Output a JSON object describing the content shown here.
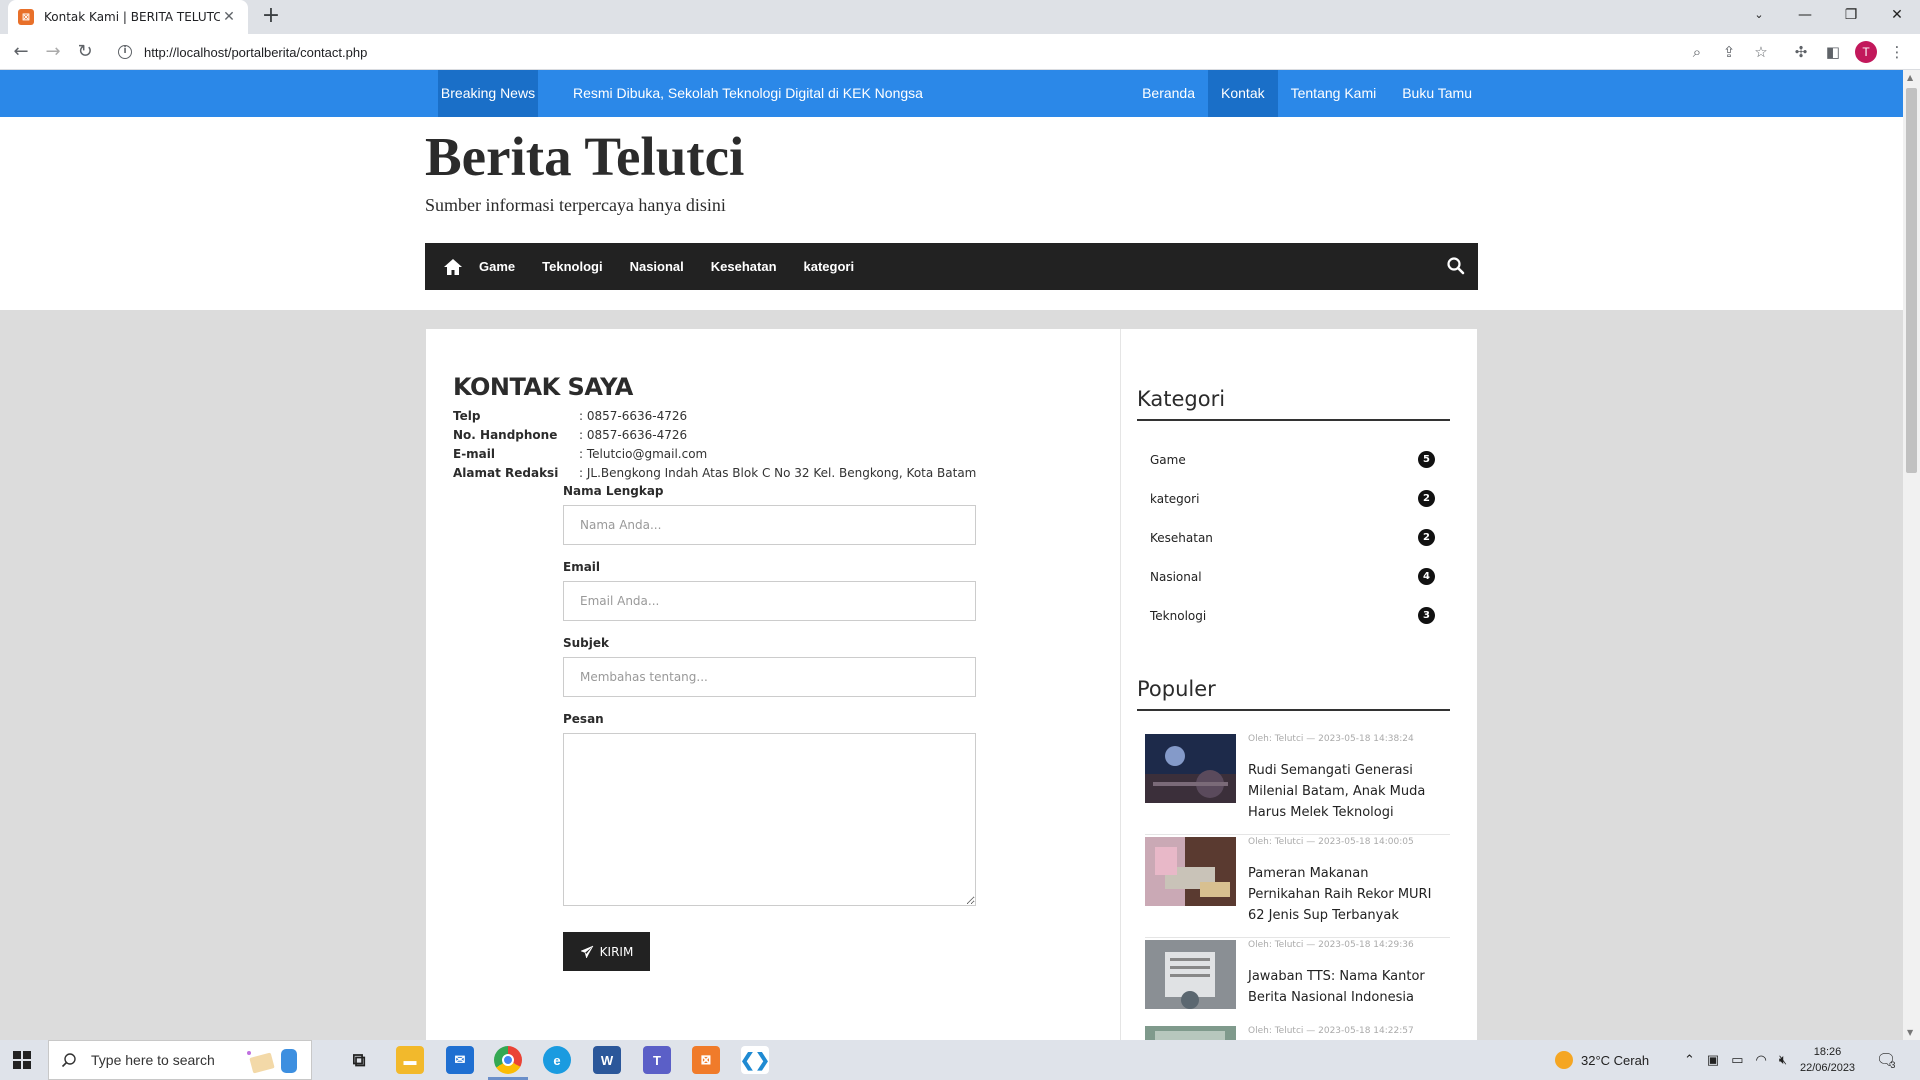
{
  "browser": {
    "tab_title": "Kontak Kami | BERITA TELUTCI",
    "tab_favicon": "xampp-icon",
    "url": "http://localhost/portalberita/contact.php",
    "profile_initial": "T"
  },
  "topbar": {
    "breaking_label": "Breaking News",
    "ticker_text": "Resmi Dibuka, Sekolah Teknologi Digital di KEK Nongsa",
    "nav": [
      "Beranda",
      "Kontak",
      "Tentang Kami",
      "Buku Tamu"
    ],
    "active_nav": "Kontak",
    "accent_color": "#2b88e8"
  },
  "header": {
    "site_title": "Berita Telutci",
    "tagline": "Sumber informasi terpercaya hanya disini"
  },
  "mainnav": {
    "items": [
      "Game",
      "Teknologi",
      "Nasional",
      "Kesehatan",
      "kategori"
    ]
  },
  "contact": {
    "heading": "KONTAK SAYA",
    "info": [
      {
        "label": "Telp",
        "value": ": 0857-6636-4726"
      },
      {
        "label": "No. Handphone",
        "value": ": 0857-6636-4726"
      },
      {
        "label": "E-mail",
        "value": ": Telutcio@gmail.com"
      },
      {
        "label": "Alamat Redaksi",
        "value": ": JL.Bengkong Indah Atas Blok C No 32 Kel. Bengkong, Kota Batam"
      }
    ],
    "form": {
      "name_label": "Nama Lengkap",
      "name_placeholder": "Nama Anda...",
      "email_label": "Email",
      "email_placeholder": "Email Anda...",
      "subject_label": "Subjek",
      "subject_placeholder": "Membahas tentang...",
      "message_label": "Pesan",
      "send_label": "KIRIM"
    }
  },
  "sidebar": {
    "kategori_title": "Kategori",
    "categories": [
      {
        "name": "Game",
        "count": "5"
      },
      {
        "name": "kategori",
        "count": "2"
      },
      {
        "name": "Kesehatan",
        "count": "2"
      },
      {
        "name": "Nasional",
        "count": "4"
      },
      {
        "name": "Teknologi",
        "count": "3"
      }
    ],
    "populer_title": "Populer",
    "popular": [
      {
        "meta": "Oleh: Telutci — 2023-05-18 14:38:24",
        "title": "Rudi Semangati Generasi Milenial Batam, Anak Muda Harus Melek Teknologi"
      },
      {
        "meta": "Oleh: Telutci — 2023-05-18 14:00:05",
        "title": "Pameran Makanan Pernikahan Raih Rekor MURI 62 Jenis Sup Terbanyak"
      },
      {
        "meta": "Oleh: Telutci — 2023-05-18 14:29:36",
        "title": "Jawaban TTS: Nama Kantor Berita Nasional Indonesia"
      },
      {
        "meta": "Oleh: Telutci — 2023-05-18 14:22:57",
        "title": ""
      }
    ]
  },
  "taskbar": {
    "search_placeholder": "Type here to search",
    "weather": "32°C  Cerah",
    "time": "18:26",
    "date": "22/06/2023",
    "notifications": "3"
  }
}
